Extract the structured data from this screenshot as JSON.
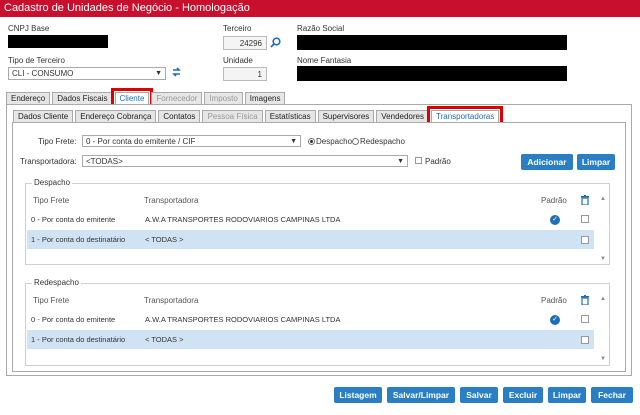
{
  "title": "Cadastro de Unidades de Negócio - Homologação",
  "form": {
    "cnpj_label": "CNPJ Base",
    "terceiro_label": "Terceiro",
    "terceiro_value": "24296",
    "razao_label": "Razão Social",
    "tipo_terceiro_label": "Tipo de Terceiro",
    "tipo_terceiro_value": "CLI - CONSUMO",
    "unidade_label": "Unidade",
    "unidade_value": "1",
    "nome_fantasia_label": "Nome Fantasia"
  },
  "main_tabs": [
    "Endereço",
    "Dados Fiscais",
    "Cliente",
    "Fornecedor",
    "Imposto",
    "Imagens"
  ],
  "sub_tabs": [
    "Dados Cliente",
    "Endereço Cobrança",
    "Contatos",
    "Pessoa Física",
    "Estatísticas",
    "Supervisores",
    "Vendedores",
    "Transportadoras"
  ],
  "transp": {
    "tipo_frete_label": "Tipo Frete:",
    "tipo_frete_value": "0 - Por conta do emitente / CIF",
    "despacho_radio": "Despacho",
    "redespacho_radio": "Redespacho",
    "transportadora_label": "Transportadora:",
    "transportadora_value": "<TODAS>",
    "padrao_check": "Padrão",
    "adicionar": "Adicionar",
    "limpar": "Limpar"
  },
  "despacho": {
    "title": "Despacho",
    "headers": {
      "tipo": "Tipo Frete",
      "transp": "Transportadora",
      "padrao": "Padrão"
    },
    "rows": [
      {
        "tipo": "0 - Por conta do emitente",
        "transp": "A.W.A TRANSPORTES RODOVIARIOS CAMPINAS LTDA",
        "padrao": true
      },
      {
        "tipo": "1 - Por conta do destinatário",
        "transp": "< TODAS >",
        "padrao": false
      }
    ]
  },
  "redespacho": {
    "title": "Redespacho",
    "headers": {
      "tipo": "Tipo Frete",
      "transp": "Transportadora",
      "padrao": "Padrão"
    },
    "rows": [
      {
        "tipo": "0 - Por conta do emitente",
        "transp": "A.W.A TRANSPORTES RODOVIARIOS CAMPINAS LTDA",
        "padrao": true
      },
      {
        "tipo": "1 - Por conta do destinatário",
        "transp": "< TODAS >",
        "padrao": false
      }
    ]
  },
  "footer_buttons": [
    "Listagem",
    "Salvar/Limpar",
    "Salvar",
    "Excluir",
    "Limpar",
    "Fechar"
  ],
  "colors": {
    "accent": "#2a7fc4",
    "titlebar": "#c8102e",
    "row_alt": "#cfe3f4",
    "highlight": "#dd0000"
  }
}
